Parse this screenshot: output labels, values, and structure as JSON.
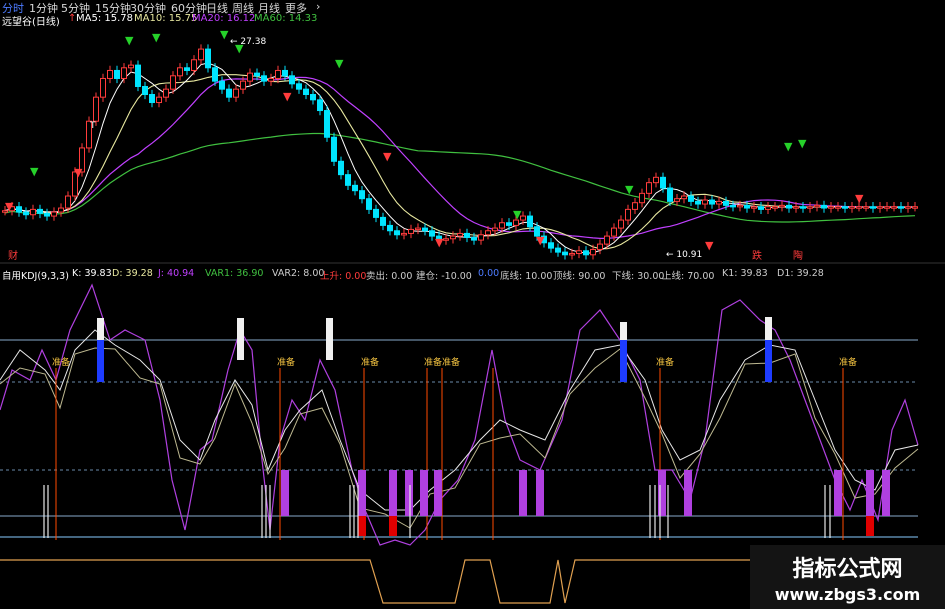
{
  "toolbar": {
    "items": [
      "分时",
      "1分钟",
      "5分钟",
      "15分钟",
      "30分钟",
      "60分钟",
      "日线",
      "周线",
      "月线",
      "更多"
    ]
  },
  "infobar": {
    "title": "远望谷(日线)",
    "ma5": "MA5: 15.78",
    "ma10": "MA10: 15.75",
    "ma20": "MA20: 16.12",
    "ma60": "MA60: 14.33"
  },
  "kdj_bar": {
    "name": "自用KDJ(9,3,3)",
    "k": "K: 39.83",
    "d": "D: 39.28",
    "j": "J: 40.94",
    "var1": "VAR1: 36.90",
    "var2": "VAR2: 8.00",
    "up": "上升: 0.00",
    "sell": "卖出: 0.00",
    "build": "建仓: -10.00",
    "zero": "0.00",
    "bottom": "底线: 10.00",
    "top": "顶线: 90.00",
    "down": "下线: 30.00",
    "upline": "上线: 70.00",
    "k1": "K1: 39.83",
    "d1": "D1: 39.28"
  },
  "annotations": {
    "high": "27.38",
    "low": "10.91",
    "signal": "准备",
    "signal2": "准备准备",
    "cai": "财",
    "die": "跌",
    "up_mark": "陶",
    "t": "T"
  },
  "watermark": {
    "line1": "指标公式网",
    "line2": "www.zbgs3.com"
  },
  "colors": {
    "up": "#ff3c3c",
    "down": "#00e5ff",
    "ma5": "#ffffff",
    "ma10": "#e8e8a0",
    "ma20": "#c040ff",
    "ma60": "#40c040",
    "kline": "#d8d8d8",
    "jline": "#b040e0",
    "signal": "#ff4a00",
    "purple_bar": "#b040e0",
    "blue_bar": "#1e3cff"
  },
  "chart_data": [
    {
      "type": "candlestick",
      "title": "远望谷(日线)",
      "series": [
        {
          "name": "MA5",
          "value_last": 15.78
        },
        {
          "name": "MA10",
          "value_last": 15.75
        },
        {
          "name": "MA20",
          "value_last": 16.12
        },
        {
          "name": "MA60",
          "value_last": 14.33
        }
      ],
      "x": [
        0,
        1,
        2,
        3,
        4,
        5,
        6,
        7,
        8,
        9,
        10,
        11,
        12,
        13,
        14,
        15,
        16,
        17,
        18,
        19,
        20,
        21,
        22,
        23,
        24,
        25,
        26,
        27,
        28,
        29,
        30,
        31,
        32,
        33,
        34,
        35,
        36,
        37,
        38,
        39,
        40,
        41,
        42,
        43,
        44,
        45,
        46,
        47,
        48,
        49,
        50,
        51,
        52,
        53,
        54,
        55,
        56,
        57,
        58,
        59,
        60,
        61,
        62,
        63,
        64,
        65,
        66,
        67,
        68,
        69,
        70,
        71,
        72,
        73,
        74,
        75,
        76,
        77,
        78,
        79,
        80,
        81,
        82,
        83,
        84,
        85,
        86,
        87,
        88,
        89,
        90,
        91,
        92,
        93,
        94,
        95,
        96,
        97,
        98,
        99,
        100,
        101,
        102,
        103,
        104,
        105,
        106,
        107,
        108,
        109,
        110,
        111,
        112,
        113,
        114,
        115,
        116,
        117,
        118,
        119,
        120,
        121,
        122,
        123,
        124,
        125,
        126,
        127,
        128,
        129,
        130
      ],
      "close": [
        14.3,
        14.6,
        14.2,
        14.0,
        14.4,
        14.1,
        13.9,
        14.2,
        14.5,
        15.4,
        17.2,
        19.0,
        21.0,
        22.8,
        24.2,
        24.8,
        24.2,
        25.0,
        25.2,
        23.6,
        23.0,
        22.4,
        22.8,
        23.4,
        24.4,
        25.0,
        24.8,
        25.6,
        26.4,
        25.0,
        24.0,
        23.4,
        22.8,
        23.4,
        24.0,
        24.6,
        24.4,
        24.0,
        24.2,
        24.8,
        24.4,
        23.8,
        23.4,
        23.0,
        22.6,
        21.8,
        19.8,
        18.0,
        17.0,
        16.2,
        15.8,
        15.2,
        14.4,
        13.8,
        13.2,
        12.8,
        12.5,
        12.6,
        12.9,
        13.0,
        12.8,
        12.4,
        12.1,
        12.2,
        12.4,
        12.6,
        12.3,
        12.1,
        12.5,
        12.8,
        13.0,
        13.4,
        13.2,
        13.6,
        13.9,
        13.1,
        12.4,
        11.9,
        11.5,
        11.2,
        11.0,
        11.1,
        11.3,
        11.0,
        11.4,
        11.8,
        12.4,
        13.0,
        13.6,
        14.4,
        14.9,
        15.6,
        16.4,
        16.8,
        16.0,
        15.0,
        15.2,
        15.4,
        15.0,
        14.8,
        15.1,
        14.8,
        15.0,
        14.7,
        14.6,
        14.7,
        14.5,
        14.6,
        14.4,
        14.6,
        14.6,
        14.7,
        14.5,
        14.6,
        14.5,
        14.6,
        14.7,
        14.5,
        14.6,
        14.6,
        14.5,
        14.6,
        14.6,
        14.6,
        14.5,
        14.6,
        14.6,
        14.6,
        14.5,
        14.6,
        14.6
      ],
      "ylim": [
        10.91,
        27.38
      ],
      "annotations": [
        "27.38",
        "10.91"
      ]
    },
    {
      "type": "line",
      "title": "自用KDJ(9,3,3)",
      "series": [
        {
          "name": "K",
          "value_last": 39.83
        },
        {
          "name": "D",
          "value_last": 39.28
        },
        {
          "name": "J",
          "value_last": 40.94
        }
      ],
      "reference_lines": {
        "底线": 10,
        "下线": 30,
        "上线": 70,
        "顶线": 90
      },
      "ylim": [
        -10,
        110
      ]
    }
  ]
}
